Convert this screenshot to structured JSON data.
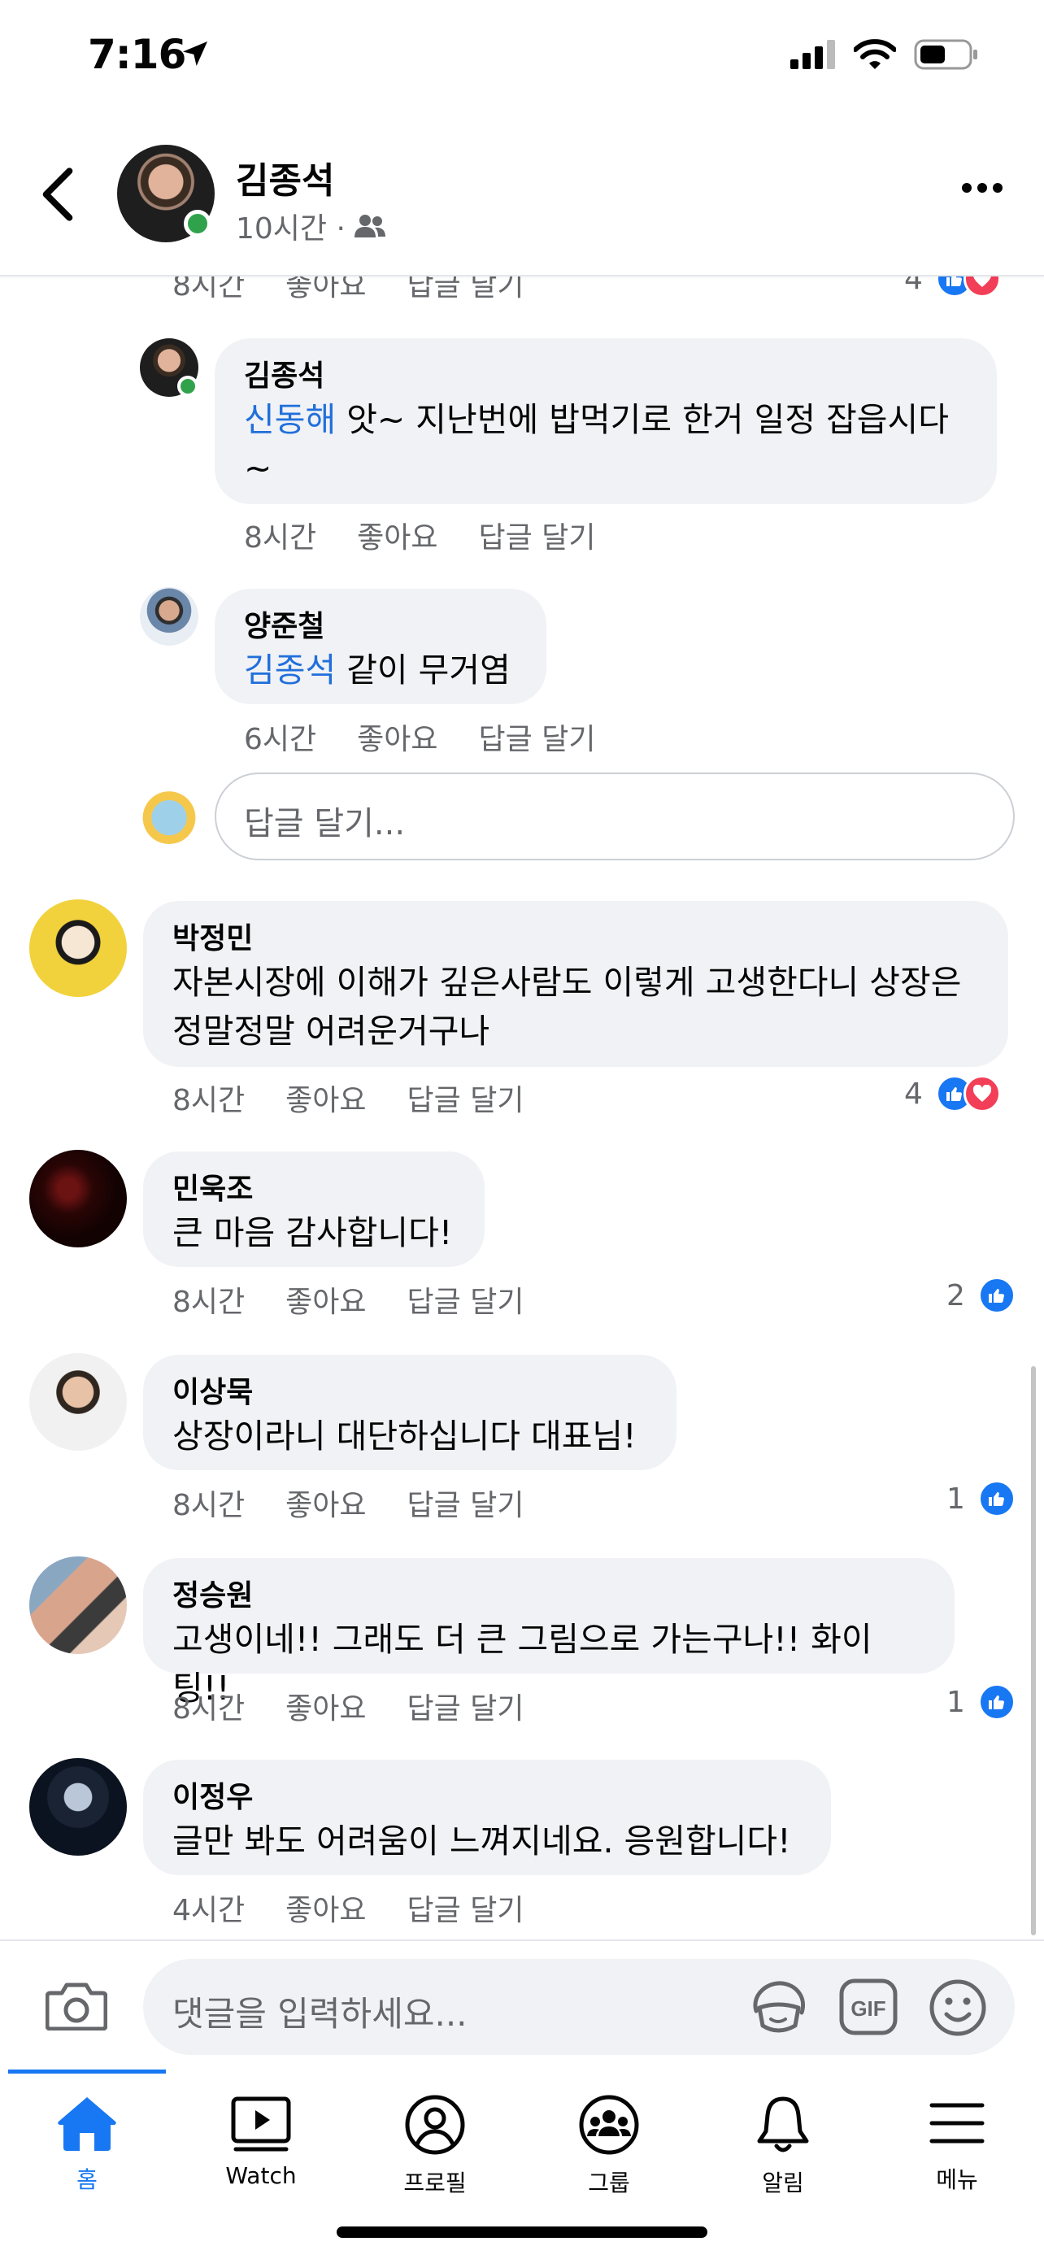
{
  "status_bar": {
    "time": "7:16"
  },
  "header": {
    "name": "김종석",
    "time": "10시간 ·"
  },
  "comments": [
    {
      "actions": {
        "time": "8시간",
        "like": "좋아요",
        "reply": "답글 달기"
      },
      "reaction_count": "4"
    },
    {
      "name": "김종석",
      "mention": "신동해",
      "text": " 앗~ 지난번에 밥먹기로 한거  일정 잡읍시다 ~",
      "actions": {
        "time": "8시간",
        "like": "좋아요",
        "reply": "답글 달기"
      }
    },
    {
      "name": "양준철",
      "mention": "김종석",
      "text": " 같이 무거염",
      "actions": {
        "time": "6시간",
        "like": "좋아요",
        "reply": "답글 달기"
      }
    },
    {
      "name": "박정민",
      "text": "자본시장에 이해가 깊은사람도 이렇게 고생한다니 상장은 정말정말 어려운거구나",
      "actions": {
        "time": "8시간",
        "like": "좋아요",
        "reply": "답글 달기"
      },
      "reaction_count": "4"
    },
    {
      "name": "민욱조",
      "text": "큰 마음 감사합니다!",
      "actions": {
        "time": "8시간",
        "like": "좋아요",
        "reply": "답글 달기"
      },
      "reaction_count": "2"
    },
    {
      "name": "이상묵",
      "text": "상장이라니 대단하십니다 대표님!",
      "actions": {
        "time": "8시간",
        "like": "좋아요",
        "reply": "답글 달기"
      },
      "reaction_count": "1"
    },
    {
      "name": "정승원",
      "text": "고생이네!! 그래도 더 큰 그림으로 가는구나!! 화이팅!!",
      "actions": {
        "time": "8시간",
        "like": "좋아요",
        "reply": "답글 달기"
      },
      "reaction_count": "1"
    },
    {
      "name": "이정우",
      "text": "글만 봐도 어려움이 느껴지네요. 응원합니다!",
      "actions": {
        "time": "4시간",
        "like": "좋아요",
        "reply": "답글 달기"
      }
    }
  ],
  "reply_input": {
    "placeholder": "답글 달기..."
  },
  "composer": {
    "placeholder": "댓글을 입력하세요..."
  },
  "tabs": [
    {
      "label": "홈",
      "icon": "home-icon",
      "active": true
    },
    {
      "label": "Watch",
      "icon": "watch-icon"
    },
    {
      "label": "프로필",
      "icon": "profile-icon"
    },
    {
      "label": "그룹",
      "icon": "groups-icon"
    },
    {
      "label": "알림",
      "icon": "bell-icon"
    },
    {
      "label": "메뉴",
      "icon": "menu-icon"
    }
  ],
  "colors": {
    "accent": "#1877f2",
    "bubble": "#f0f2f5",
    "love": "#f33e58",
    "online": "#31a24c",
    "mention": "#216fdb"
  }
}
